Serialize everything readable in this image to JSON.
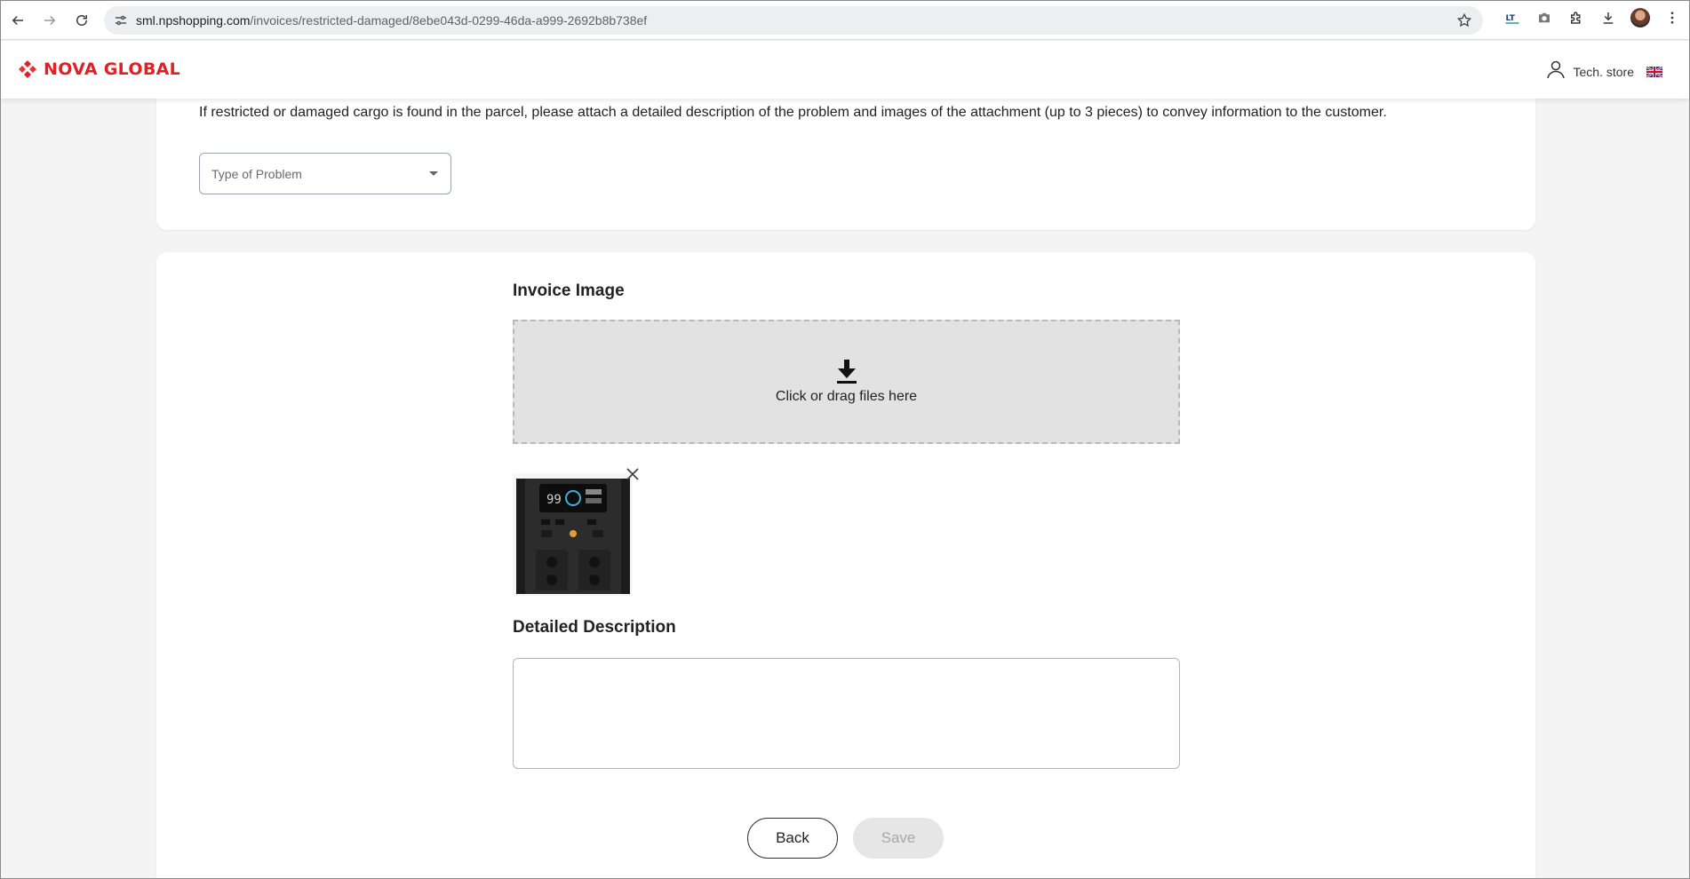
{
  "browser": {
    "url_host": "sml.npshopping.com",
    "url_path": "/invoices/restricted-damaged/8ebe043d-0299-46da-a999-2692b8b738ef"
  },
  "header": {
    "logo_text": "NOVA GLOBAL",
    "store_name": "Tech. store",
    "brand_color": "#e31e24"
  },
  "problem_section": {
    "intro": "If restricted or damaged cargo is found in the parcel, please attach a detailed description of the problem and images of the attachment (up to 3 pieces) to convey information to the customer.",
    "type_select_placeholder": "Type of Problem"
  },
  "invoice_image": {
    "title": "Invoice Image",
    "drop_label": "Click or drag files here",
    "thumbnail_icon": "power-station-image"
  },
  "description": {
    "title": "Detailed Description",
    "value": ""
  },
  "actions": {
    "back_label": "Back",
    "save_label": "Save"
  }
}
